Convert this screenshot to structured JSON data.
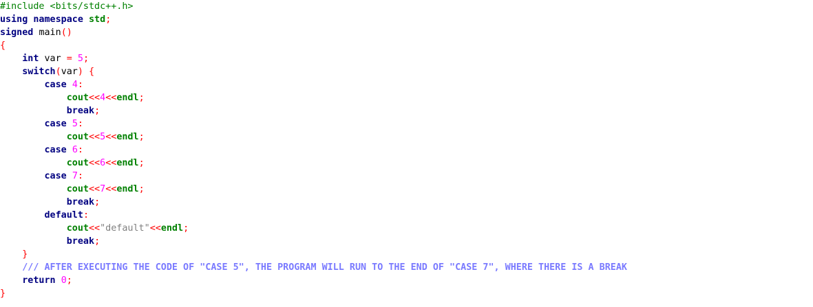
{
  "editor": {
    "colors": {
      "background": "#ffffff",
      "preprocessor": "#008000",
      "keyword": "#000080",
      "number": "#ff00ff",
      "operator": "#ff0000",
      "std_identifier": "#008000",
      "string": "#808080",
      "doc_comment": "#7a7aff"
    },
    "lines": [
      {
        "tokens": [
          {
            "t": "pre",
            "v": "#include <bits/stdc++.h>"
          }
        ]
      },
      {
        "tokens": [
          {
            "t": "kw",
            "v": "using"
          },
          {
            "t": "plain",
            "v": " "
          },
          {
            "t": "kw",
            "v": "namespace"
          },
          {
            "t": "plain",
            "v": " "
          },
          {
            "t": "std",
            "v": "std"
          },
          {
            "t": "op",
            "v": ";"
          }
        ]
      },
      {
        "tokens": [
          {
            "t": "kw",
            "v": "signed"
          },
          {
            "t": "plain",
            "v": " "
          },
          {
            "t": "id",
            "v": "main"
          },
          {
            "t": "op",
            "v": "()"
          }
        ]
      },
      {
        "tokens": [
          {
            "t": "op",
            "v": "{"
          }
        ]
      },
      {
        "tokens": [
          {
            "t": "plain",
            "v": "    "
          },
          {
            "t": "kw",
            "v": "int"
          },
          {
            "t": "plain",
            "v": " "
          },
          {
            "t": "id",
            "v": "var"
          },
          {
            "t": "plain",
            "v": " "
          },
          {
            "t": "op",
            "v": "="
          },
          {
            "t": "plain",
            "v": " "
          },
          {
            "t": "num",
            "v": "5"
          },
          {
            "t": "op",
            "v": ";"
          }
        ]
      },
      {
        "tokens": [
          {
            "t": "plain",
            "v": "    "
          },
          {
            "t": "kw",
            "v": "switch"
          },
          {
            "t": "op",
            "v": "("
          },
          {
            "t": "id",
            "v": "var"
          },
          {
            "t": "op",
            "v": ")"
          },
          {
            "t": "plain",
            "v": " "
          },
          {
            "t": "op",
            "v": "{"
          }
        ]
      },
      {
        "tokens": [
          {
            "t": "plain",
            "v": "        "
          },
          {
            "t": "kw",
            "v": "case"
          },
          {
            "t": "plain",
            "v": " "
          },
          {
            "t": "num",
            "v": "4"
          },
          {
            "t": "op",
            "v": ":"
          }
        ]
      },
      {
        "tokens": [
          {
            "t": "plain",
            "v": "            "
          },
          {
            "t": "std",
            "v": "cout"
          },
          {
            "t": "op",
            "v": "<<"
          },
          {
            "t": "num",
            "v": "4"
          },
          {
            "t": "op",
            "v": "<<"
          },
          {
            "t": "std",
            "v": "endl"
          },
          {
            "t": "op",
            "v": ";"
          }
        ]
      },
      {
        "tokens": [
          {
            "t": "plain",
            "v": "            "
          },
          {
            "t": "kw",
            "v": "break"
          },
          {
            "t": "op",
            "v": ";"
          }
        ]
      },
      {
        "tokens": [
          {
            "t": "plain",
            "v": "        "
          },
          {
            "t": "kw",
            "v": "case"
          },
          {
            "t": "plain",
            "v": " "
          },
          {
            "t": "num",
            "v": "5"
          },
          {
            "t": "op",
            "v": ":"
          }
        ]
      },
      {
        "tokens": [
          {
            "t": "plain",
            "v": "            "
          },
          {
            "t": "std",
            "v": "cout"
          },
          {
            "t": "op",
            "v": "<<"
          },
          {
            "t": "num",
            "v": "5"
          },
          {
            "t": "op",
            "v": "<<"
          },
          {
            "t": "std",
            "v": "endl"
          },
          {
            "t": "op",
            "v": ";"
          }
        ]
      },
      {
        "tokens": [
          {
            "t": "plain",
            "v": "        "
          },
          {
            "t": "kw",
            "v": "case"
          },
          {
            "t": "plain",
            "v": " "
          },
          {
            "t": "num",
            "v": "6"
          },
          {
            "t": "op",
            "v": ":"
          }
        ]
      },
      {
        "tokens": [
          {
            "t": "plain",
            "v": "            "
          },
          {
            "t": "std",
            "v": "cout"
          },
          {
            "t": "op",
            "v": "<<"
          },
          {
            "t": "num",
            "v": "6"
          },
          {
            "t": "op",
            "v": "<<"
          },
          {
            "t": "std",
            "v": "endl"
          },
          {
            "t": "op",
            "v": ";"
          }
        ]
      },
      {
        "tokens": [
          {
            "t": "plain",
            "v": "        "
          },
          {
            "t": "kw",
            "v": "case"
          },
          {
            "t": "plain",
            "v": " "
          },
          {
            "t": "num",
            "v": "7"
          },
          {
            "t": "op",
            "v": ":"
          }
        ]
      },
      {
        "tokens": [
          {
            "t": "plain",
            "v": "            "
          },
          {
            "t": "std",
            "v": "cout"
          },
          {
            "t": "op",
            "v": "<<"
          },
          {
            "t": "num",
            "v": "7"
          },
          {
            "t": "op",
            "v": "<<"
          },
          {
            "t": "std",
            "v": "endl"
          },
          {
            "t": "op",
            "v": ";"
          }
        ]
      },
      {
        "tokens": [
          {
            "t": "plain",
            "v": "            "
          },
          {
            "t": "kw",
            "v": "break"
          },
          {
            "t": "op",
            "v": ";"
          }
        ]
      },
      {
        "tokens": [
          {
            "t": "plain",
            "v": "        "
          },
          {
            "t": "kw",
            "v": "default"
          },
          {
            "t": "op",
            "v": ":"
          }
        ]
      },
      {
        "tokens": [
          {
            "t": "plain",
            "v": "            "
          },
          {
            "t": "std",
            "v": "cout"
          },
          {
            "t": "op",
            "v": "<<"
          },
          {
            "t": "str",
            "v": "\"default\""
          },
          {
            "t": "op",
            "v": "<<"
          },
          {
            "t": "std",
            "v": "endl"
          },
          {
            "t": "op",
            "v": ";"
          }
        ]
      },
      {
        "tokens": [
          {
            "t": "plain",
            "v": "            "
          },
          {
            "t": "kw",
            "v": "break"
          },
          {
            "t": "op",
            "v": ";"
          }
        ]
      },
      {
        "tokens": [
          {
            "t": "plain",
            "v": "    "
          },
          {
            "t": "op",
            "v": "}"
          }
        ]
      },
      {
        "tokens": [
          {
            "t": "plain",
            "v": "    "
          },
          {
            "t": "cmt",
            "v": "/// AFTER EXECUTING THE CODE OF \"CASE 5\", THE PROGRAM WILL RUN TO THE END OF \"CASE 7\", WHERE THERE IS A BREAK"
          }
        ]
      },
      {
        "tokens": [
          {
            "t": "plain",
            "v": "    "
          },
          {
            "t": "kw",
            "v": "return"
          },
          {
            "t": "plain",
            "v": " "
          },
          {
            "t": "num",
            "v": "0"
          },
          {
            "t": "op",
            "v": ";"
          }
        ]
      },
      {
        "tokens": [
          {
            "t": "op",
            "v": "}"
          }
        ]
      }
    ]
  }
}
